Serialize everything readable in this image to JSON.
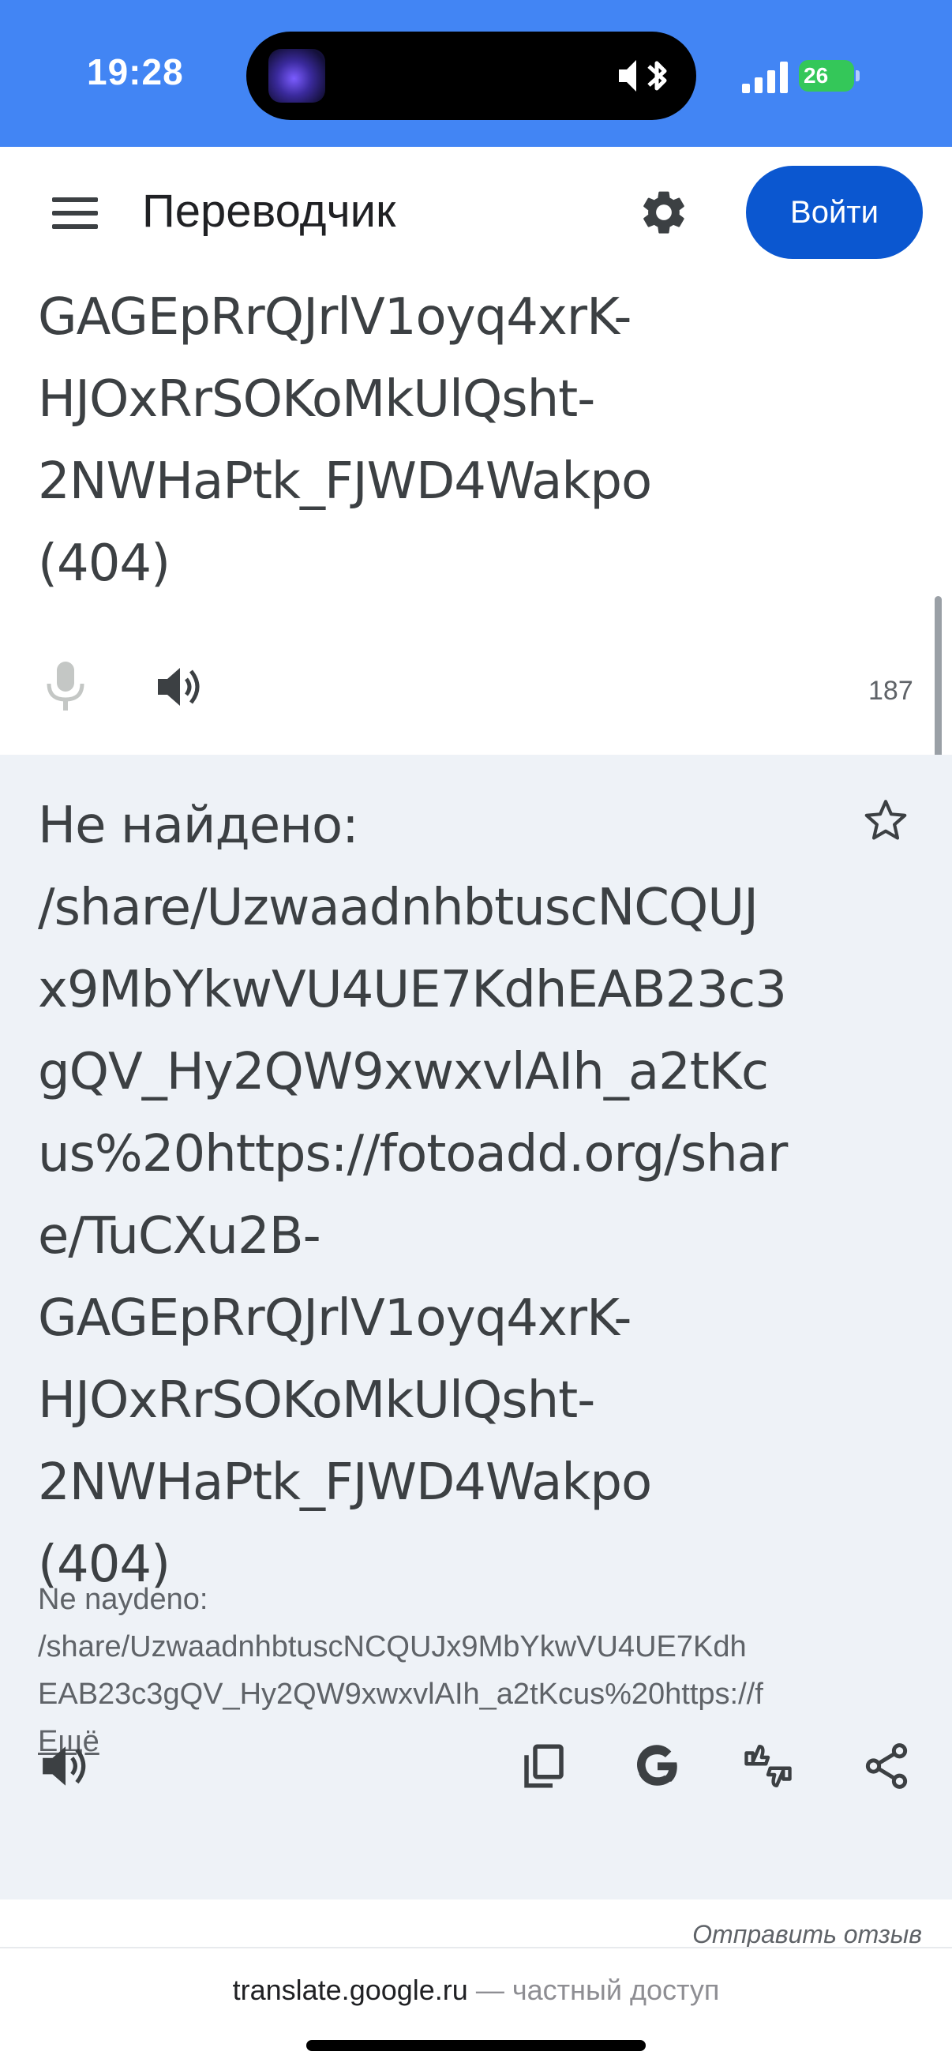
{
  "status_bar": {
    "time": "19:28",
    "battery": "26",
    "accent": "#4285f4"
  },
  "header": {
    "title": "Переводчик",
    "login_label": "Войти",
    "menu_icon": "menu-icon",
    "settings_icon": "gear-icon"
  },
  "source": {
    "lines": [
      "GAGEpRrQJrlV1oyq4xrK-",
      "HJOxRrSOKoMkUlQsht-",
      "2NWHaPtk_FJWD4Wakpo",
      "(404)"
    ],
    "char_count": "187"
  },
  "result": {
    "lines": [
      "Не найдено:",
      "/share/UzwaadnhbtuscNCQUJ",
      "x9MbYkwVU4UE7KdhEAB23c3",
      "gQV_Hy2QW9xwxvlAIh_a2tKc",
      "us%20https://fotoadd.org/shar",
      "e/TuCXu2B-",
      "GAGEpRrQJrlV1oyq4xrK-",
      "HJOxRrSOKoMkUlQsht-",
      "2NWHaPtk_FJWD4Wakpo",
      "(404)"
    ],
    "transliteration": [
      "Ne naydeno:",
      "/share/UzwaadnhbtuscNCQUJx9MbYkwVU4UE7Kdh",
      "EAB23c3gQV_Hy2QW9xwxvlAIh_a2tKcus%20https://f"
    ],
    "more_label": "Ещё",
    "panel_color": "#eef2f7"
  },
  "feedback_label": "Отправить отзыв",
  "browser": {
    "host": "translate.google.ru",
    "note": " — частный доступ"
  }
}
